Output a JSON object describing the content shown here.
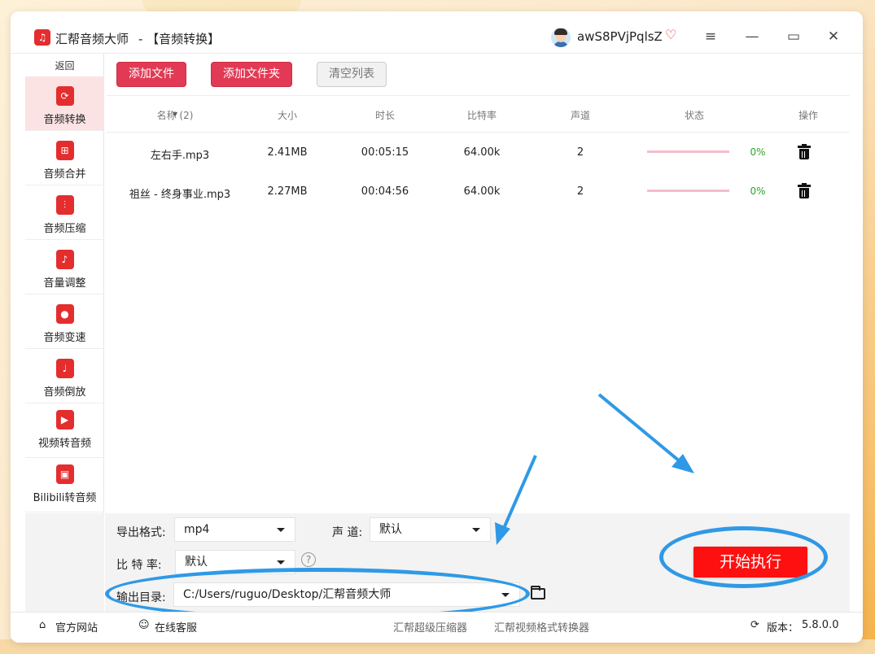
{
  "app": {
    "title": "汇帮音频大师",
    "subtitle": "-  【音频转换】",
    "username": "awS8PVjPqlsZ",
    "window_buttons": {
      "menu": "≡",
      "minimize": "—",
      "maximize": "▭",
      "close": "✕"
    }
  },
  "sidebar": {
    "back": "返回",
    "items": [
      {
        "label": "音频转换",
        "icon": "audio-convert-icon",
        "active": true
      },
      {
        "label": "音频合并",
        "icon": "audio-merge-icon"
      },
      {
        "label": "音频压缩",
        "icon": "audio-compress-icon"
      },
      {
        "label": "音量调整",
        "icon": "volume-adjust-icon"
      },
      {
        "label": "音频变速",
        "icon": "audio-speed-icon"
      },
      {
        "label": "音频倒放",
        "icon": "audio-reverse-icon"
      },
      {
        "label": "视频转音频",
        "icon": "video-to-audio-icon"
      },
      {
        "label": "Bilibili转音频",
        "icon": "bilibili-icon"
      }
    ]
  },
  "toolbar": {
    "add_file": "添加文件",
    "add_folder": "添加文件夹",
    "clear_list": "清空列表"
  },
  "table": {
    "headers": {
      "name": "名称 (2)",
      "size": "大小",
      "duration": "时长",
      "bitrate": "比特率",
      "channels": "声道",
      "status": "状态",
      "action": "操作"
    },
    "rows": [
      {
        "name": "左右手.mp3",
        "size": "2.41MB",
        "duration": "00:05:15",
        "bitrate": "64.00k",
        "channels": "2",
        "progress": "0%"
      },
      {
        "name": "祖丝 - 终身事业.mp3",
        "size": "2.27MB",
        "duration": "00:04:56",
        "bitrate": "64.00k",
        "channels": "2",
        "progress": "0%"
      }
    ]
  },
  "settings": {
    "format_label": "导出格式:",
    "format_value": "mp4",
    "channel_label": "声 道:",
    "channel_value": "默认",
    "bitrate_label": "比 特 率:",
    "bitrate_value": "默认",
    "help": "?",
    "output_label": "输出目录:",
    "output_value": "C:/Users/ruguo/Desktop/汇帮音频大师",
    "start_button": "开始执行"
  },
  "footer": {
    "website": "官方网站",
    "support": "在线客服",
    "compressor": "汇帮超级压缩器",
    "video_converter": "汇帮视频格式转换器",
    "version_label": "版本：",
    "version": "5.8.0.0"
  },
  "colors": {
    "accent_red": "#e23a55",
    "start_red": "#ff1010",
    "annotation_blue": "#2f99e6",
    "progress_green": "#2aa52a"
  }
}
